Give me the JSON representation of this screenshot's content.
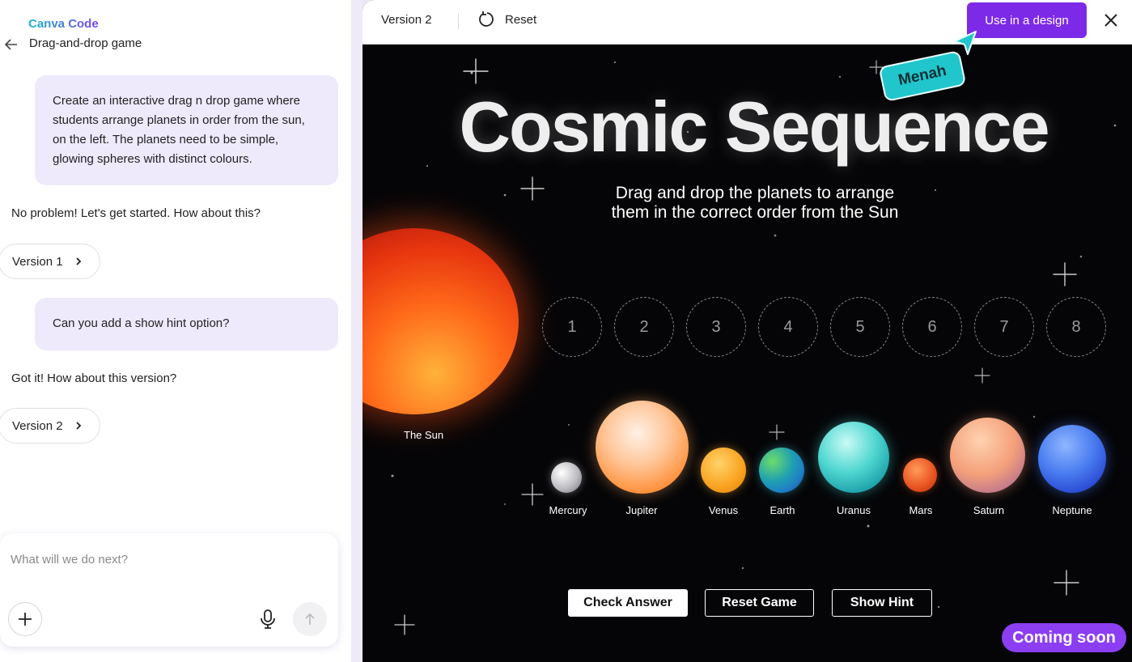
{
  "sidebar": {
    "brand": "Canva Code",
    "project_title": "Drag-and-drop game",
    "messages": [
      {
        "role": "user",
        "text": "Create an interactive drag n drop game where students arrange planets in order from the sun, on the left. The planets need to be simple, glowing spheres with distinct colours."
      },
      {
        "role": "assistant",
        "text": "No problem! Let's get started. How about this?"
      },
      {
        "role": "user",
        "text": "Can you add a show hint option?"
      },
      {
        "role": "assistant",
        "text": "Got it! How about this version?"
      }
    ],
    "versions": [
      "Version 1",
      "Version 2"
    ],
    "composer_placeholder": "What will we do next?"
  },
  "toolbar": {
    "version_label": "Version 2",
    "reset_label": "Reset",
    "use_button": "Use in a design"
  },
  "game": {
    "title": "Cosmic Sequence",
    "subtitle_line1": "Drag and drop the planets to arrange",
    "subtitle_line2": "them in the correct order from the Sun",
    "sun_label": "The Sun",
    "slots": [
      "1",
      "2",
      "3",
      "4",
      "5",
      "6",
      "7",
      "8"
    ],
    "planets": [
      {
        "name": "Mercury",
        "color": "#c8c8cc"
      },
      {
        "name": "Jupiter",
        "color": "#ff9a4a"
      },
      {
        "name": "Venus",
        "color": "#f9a21f"
      },
      {
        "name": "Earth",
        "color": "#1f7fc6"
      },
      {
        "name": "Uranus",
        "color": "#23b9b9"
      },
      {
        "name": "Mars",
        "color": "#e8521f"
      },
      {
        "name": "Saturn",
        "color": "#f4a07a"
      },
      {
        "name": "Neptune",
        "color": "#2d5fe6"
      }
    ],
    "buttons": {
      "check": "Check Answer",
      "reset": "Reset Game",
      "hint": "Show Hint"
    }
  },
  "overlays": {
    "cursor_tag": "Menah",
    "coming_soon": "Coming soon"
  },
  "colors": {
    "accent": "#7d2ae8",
    "tag": "#21c6cc",
    "bubble": "#eeeafc"
  }
}
